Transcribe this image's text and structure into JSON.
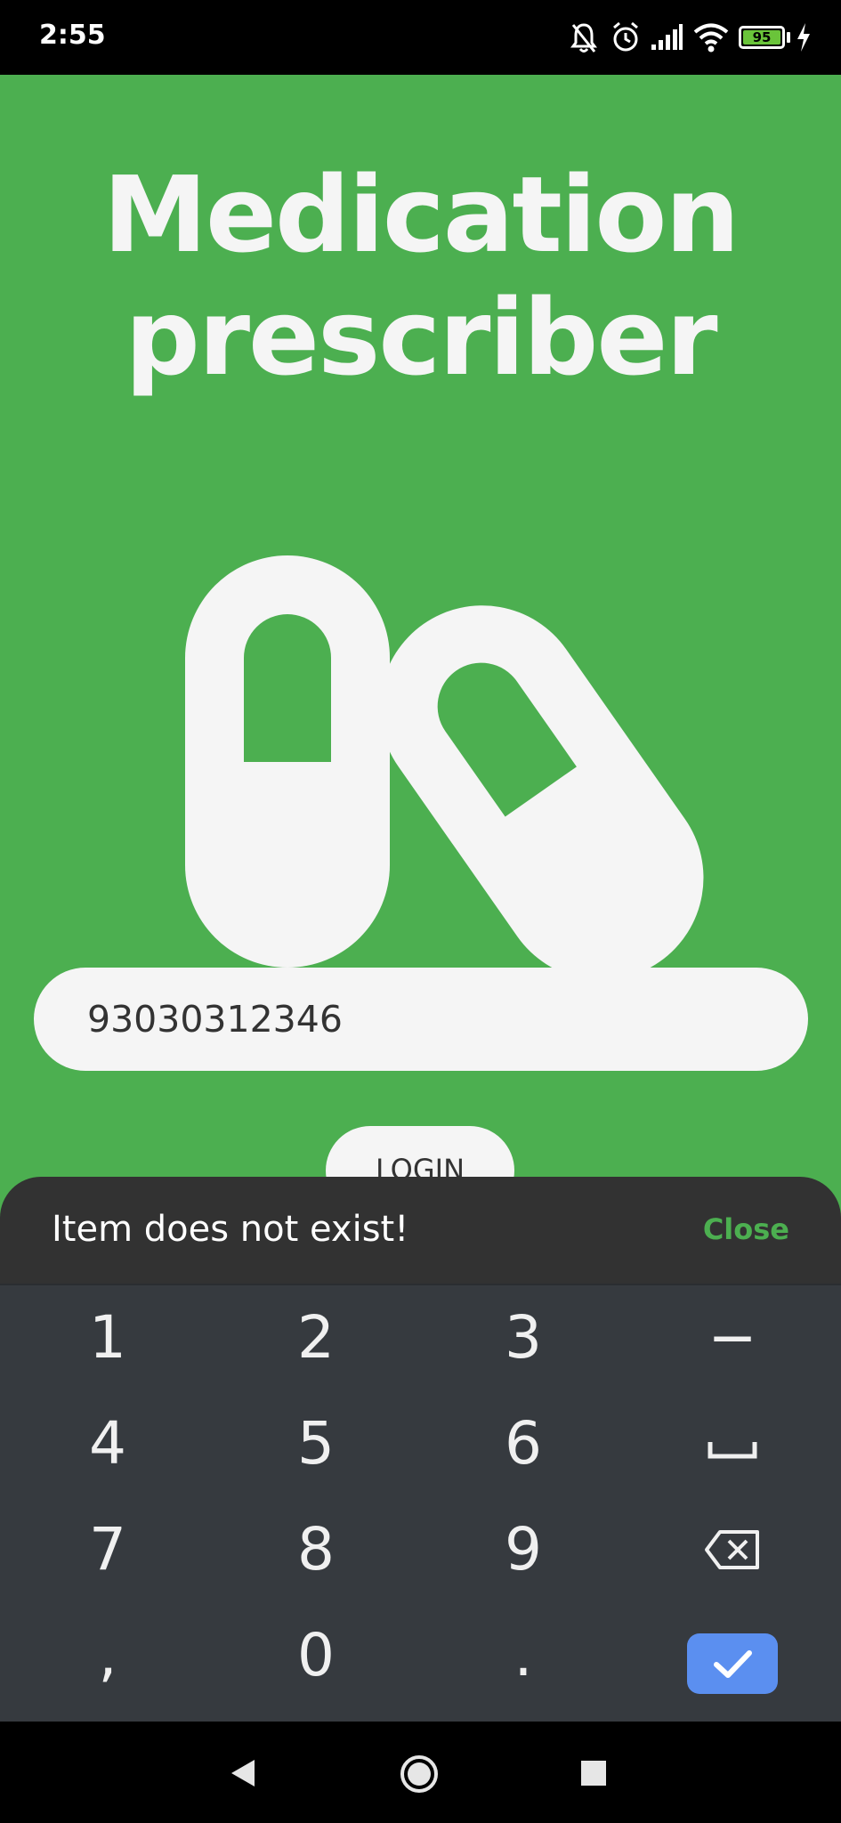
{
  "status_bar": {
    "time": "2:55",
    "battery": "95",
    "icons": [
      "bell-off-icon",
      "alarm-icon",
      "cell-signal-icon",
      "wifi-icon",
      "battery-icon",
      "charging-icon"
    ]
  },
  "app": {
    "title_line1": "Medication",
    "title_line2": "prescriber",
    "id_field_value": "93030312346",
    "login_label": "LOGIN",
    "colors": {
      "background": "#4caf50",
      "surface": "#f5f5f5"
    }
  },
  "snackbar": {
    "message": "Item does not exist!",
    "action_label": "Close",
    "action_color": "#4caf50"
  },
  "keyboard": {
    "rows": [
      [
        "1",
        "2",
        "3",
        "−"
      ],
      [
        "4",
        "5",
        "6",
        "␣"
      ],
      [
        "7",
        "8",
        "9",
        "⌫"
      ],
      [
        ",",
        "0",
        ".",
        "✓"
      ]
    ],
    "accent_color": "#5b8ff0"
  },
  "nav_bar": {
    "icons": [
      "back-icon",
      "home-icon",
      "recents-icon"
    ]
  }
}
